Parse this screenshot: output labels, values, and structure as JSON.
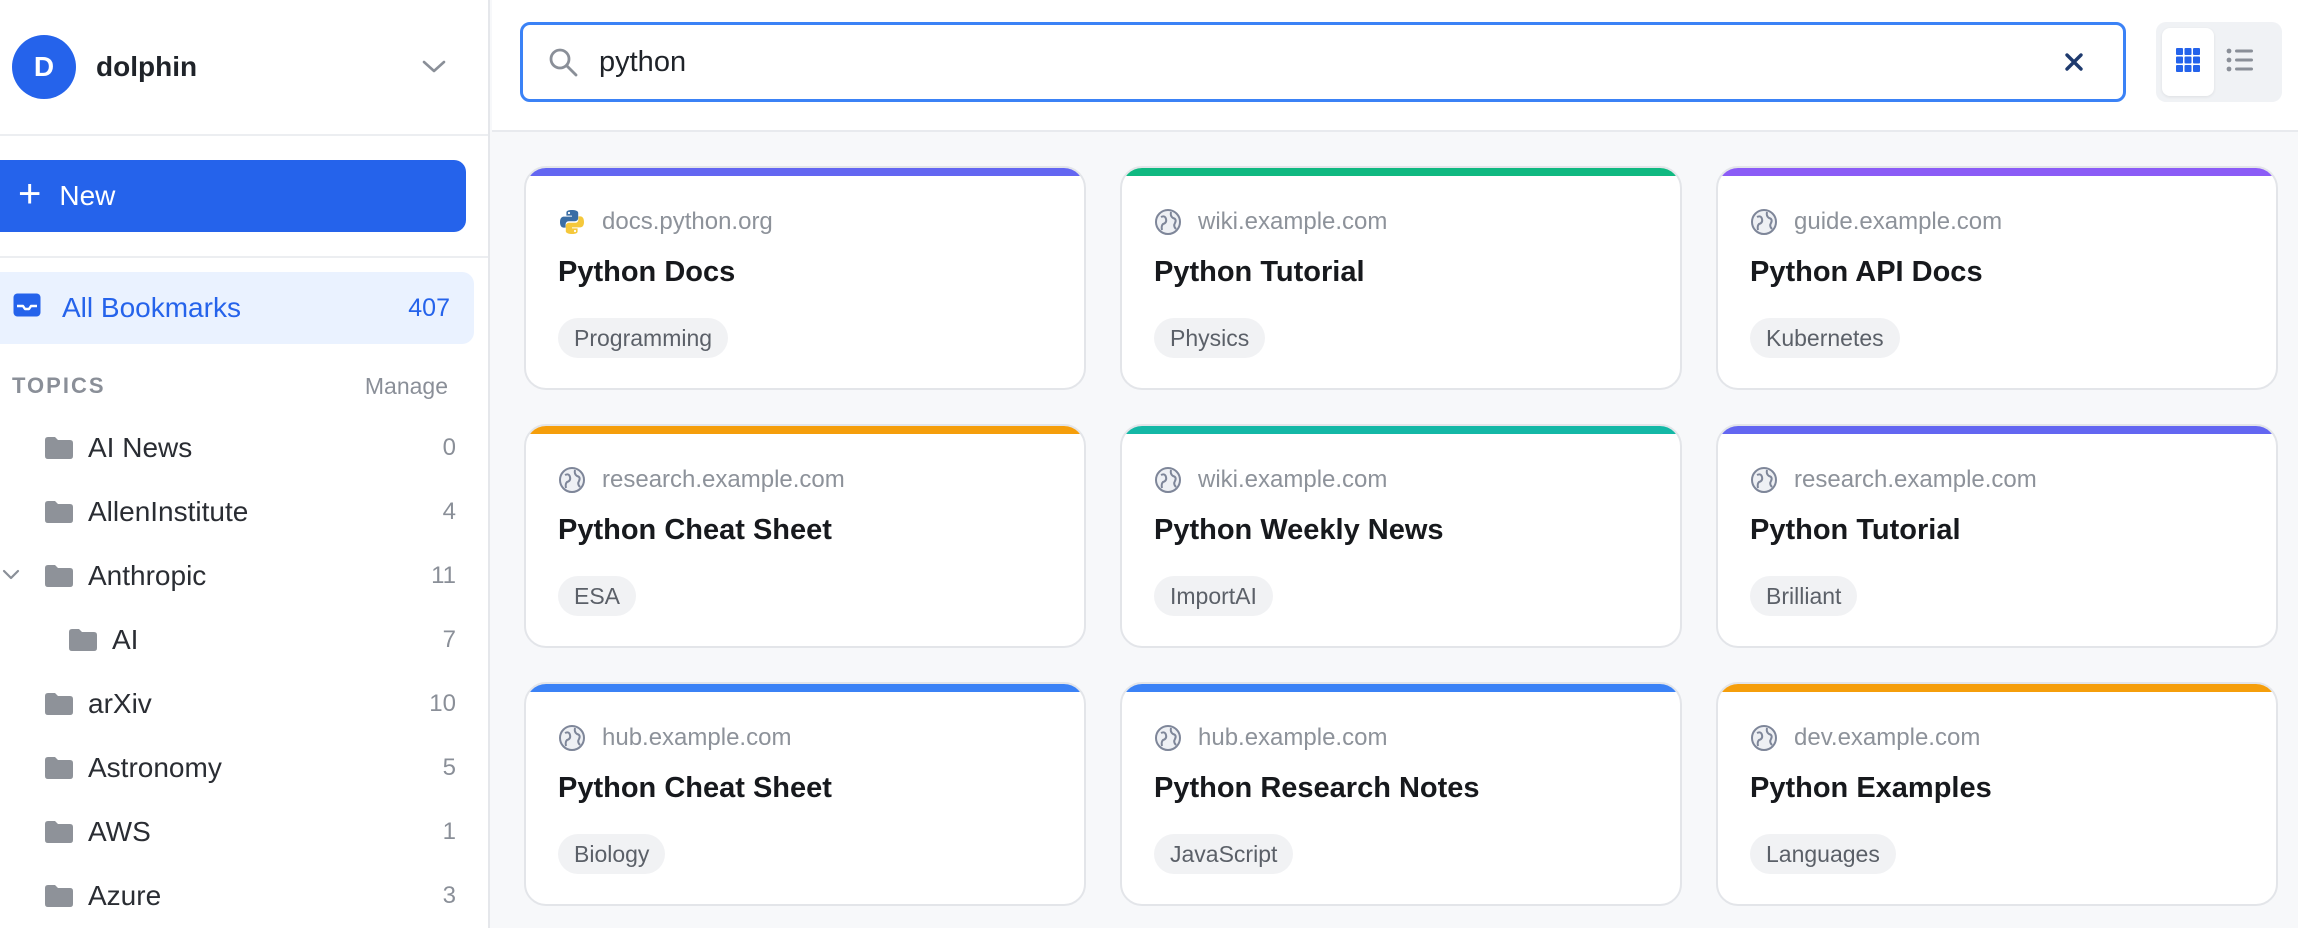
{
  "account": {
    "initial": "D",
    "name": "dolphin"
  },
  "new_button": {
    "label": "New"
  },
  "all_bookmarks": {
    "label": "All Bookmarks",
    "count": "407"
  },
  "topics": {
    "title": "TOPICS",
    "manage": "Manage",
    "items": [
      {
        "label": "AI News",
        "count": "0",
        "expanded": false,
        "child": false
      },
      {
        "label": "AllenInstitute",
        "count": "4",
        "expanded": false,
        "child": false
      },
      {
        "label": "Anthropic",
        "count": "11",
        "expanded": true,
        "child": false
      },
      {
        "label": "AI",
        "count": "7",
        "expanded": false,
        "child": true
      },
      {
        "label": "arXiv",
        "count": "10",
        "expanded": false,
        "child": false
      },
      {
        "label": "Astronomy",
        "count": "5",
        "expanded": false,
        "child": false
      },
      {
        "label": "AWS",
        "count": "1",
        "expanded": false,
        "child": false
      },
      {
        "label": "Azure",
        "count": "3",
        "expanded": false,
        "child": false
      }
    ]
  },
  "search": {
    "value": "python",
    "placeholder": ""
  },
  "view": {
    "active": "grid"
  },
  "colors": {
    "accent": "#2563eb",
    "indigo": "#6366f1",
    "green": "#10b981",
    "purple": "#8b5cf6",
    "orange": "#f59e0b",
    "teal": "#14b8a6",
    "blue": "#3b82f6"
  },
  "cards": [
    {
      "domain": "docs.python.org",
      "title": "Python Docs",
      "tag": "Programming",
      "color": "#6366f1",
      "favicon": "python-icon"
    },
    {
      "domain": "wiki.example.com",
      "title": "Python Tutorial",
      "tag": "Physics",
      "color": "#10b981",
      "favicon": "globe-icon"
    },
    {
      "domain": "guide.example.com",
      "title": "Python API Docs",
      "tag": "Kubernetes",
      "color": "#8b5cf6",
      "favicon": "globe-icon"
    },
    {
      "domain": "research.example.com",
      "title": "Python Cheat Sheet",
      "tag": "ESA",
      "color": "#f59e0b",
      "favicon": "globe-icon"
    },
    {
      "domain": "wiki.example.com",
      "title": "Python Weekly News",
      "tag": "ImportAI",
      "color": "#14b8a6",
      "favicon": "globe-icon"
    },
    {
      "domain": "research.example.com",
      "title": "Python Tutorial",
      "tag": "Brilliant",
      "color": "#6366f1",
      "favicon": "globe-icon"
    },
    {
      "domain": "hub.example.com",
      "title": "Python Cheat Sheet",
      "tag": "Biology",
      "color": "#3b82f6",
      "favicon": "globe-icon"
    },
    {
      "domain": "hub.example.com",
      "title": "Python Research Notes",
      "tag": "JavaScript",
      "color": "#3b82f6",
      "favicon": "globe-icon"
    },
    {
      "domain": "dev.example.com",
      "title": "Python Examples",
      "tag": "Languages",
      "color": "#f59e0b",
      "favicon": "globe-icon"
    }
  ]
}
